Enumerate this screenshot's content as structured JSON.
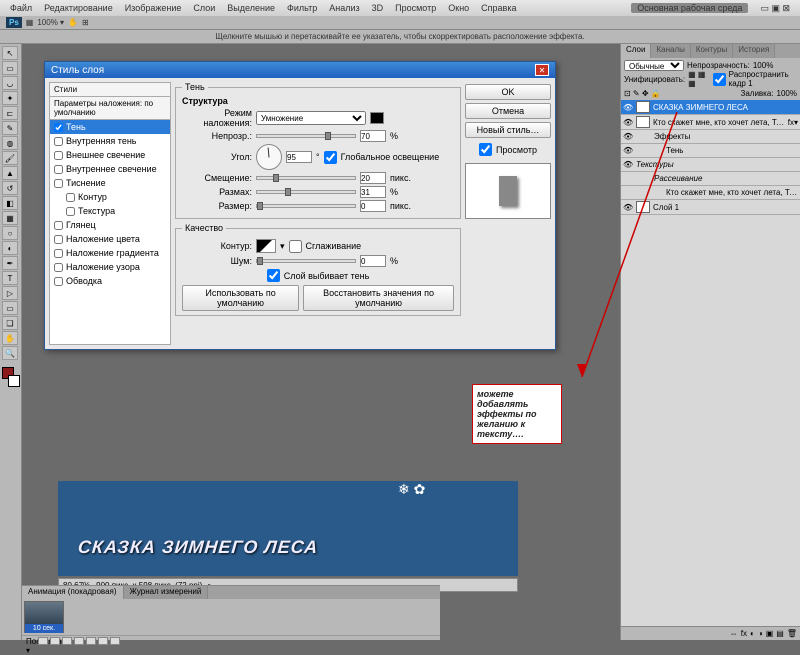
{
  "menu": {
    "items": [
      "Файл",
      "Редактирование",
      "Изображение",
      "Слои",
      "Выделение",
      "Фильтр",
      "Анализ",
      "3D",
      "Просмотр",
      "Окно",
      "Справка"
    ],
    "workspace": "Основная рабочая среда"
  },
  "toolbar": {
    "ps": "Ps",
    "zoom": "100% ▾"
  },
  "hint": "Щелкните мышью и перетаскивайте ее указатель, чтобы скорректировать расположение эффекта.",
  "dialog": {
    "title": "Стиль слоя",
    "styles_head": "Стили",
    "params": "Параметры наложения: по умолчанию",
    "list": [
      {
        "label": "Тень",
        "checked": true,
        "sel": true
      },
      {
        "label": "Внутренняя тень",
        "checked": false
      },
      {
        "label": "Внешнее свечение",
        "checked": false
      },
      {
        "label": "Внутреннее свечение",
        "checked": false
      },
      {
        "label": "Тиснение",
        "checked": false
      },
      {
        "label": "Контур",
        "checked": false,
        "indent": true
      },
      {
        "label": "Текстура",
        "checked": false,
        "indent": true
      },
      {
        "label": "Глянец",
        "checked": false
      },
      {
        "label": "Наложение цвета",
        "checked": false
      },
      {
        "label": "Наложение градиента",
        "checked": false
      },
      {
        "label": "Наложение узора",
        "checked": false
      },
      {
        "label": "Обводка",
        "checked": false
      }
    ],
    "shadow": {
      "group": "Тень",
      "struct": "Структура",
      "mode_l": "Режим наложения:",
      "mode": "Умножение",
      "opac_l": "Непрозр.:",
      "opac": "70",
      "pct": "%",
      "angle_l": "Угол:",
      "angle": "95",
      "deg": "°",
      "global": "Глобальное освещение",
      "dist_l": "Смещение:",
      "dist": "20",
      "px": "пикс.",
      "spread_l": "Размах:",
      "spread": "31",
      "size_l": "Размер:",
      "size": "0",
      "quality": "Качество",
      "contour_l": "Контур:",
      "aa": "Сглаживание",
      "noise_l": "Шум:",
      "noise": "0",
      "knock": "Слой выбивает тень",
      "defaults": "Использовать по умолчанию",
      "reset": "Восстановить значения по умолчанию"
    },
    "ok": "OK",
    "cancel": "Отмена",
    "new": "Новый стиль…",
    "preview": "Просмотр"
  },
  "doc": {
    "text": "СКАЗКА   ЗИМНЕГО   ЛЕСА",
    "zoom": "80,67%",
    "info": "900 пикс. x 598 пикс. (72 ppi)"
  },
  "anim": {
    "tab1": "Анимация (покадровая)",
    "tab2": "Журнал измерений",
    "frame": "10 сек.",
    "loop": "Постоянно ▾"
  },
  "panels": {
    "tabs1": [
      "Слои",
      "Каналы",
      "Контуры",
      "История"
    ],
    "blend": "Обычные",
    "opac_l": "Непрозрачность:",
    "opac": "100%",
    "lock": "Унифицировать:",
    "fill_l": "Заливка:",
    "fill": "100%",
    "spread": "Распространить кадр 1",
    "layers": [
      {
        "name": "СКАЗКА  ЗИМНЕГО  ЛЕСА",
        "sel": true,
        "thumb": true,
        "vis": true
      },
      {
        "name": "Кто скажет мне, кто хочет лета,   Тот никогд…",
        "thumb": true,
        "fx": "fx",
        "vis": true
      },
      {
        "name": "Эффекты",
        "indent": 1,
        "vis": true
      },
      {
        "name": "Тень",
        "indent": 2,
        "vis": true
      },
      {
        "name": "Текстуры",
        "italic": true,
        "vis": true
      },
      {
        "name": "Рассеивание",
        "indent": 1,
        "italic": true
      },
      {
        "name": "Кто скажет мне, кто хочет лета,   Тот никогда …",
        "indent": 2
      },
      {
        "name": "Слой 1",
        "thumb": true,
        "vis": true
      }
    ]
  },
  "annot": "можете добавлять эффекты по желанию к тексту…."
}
